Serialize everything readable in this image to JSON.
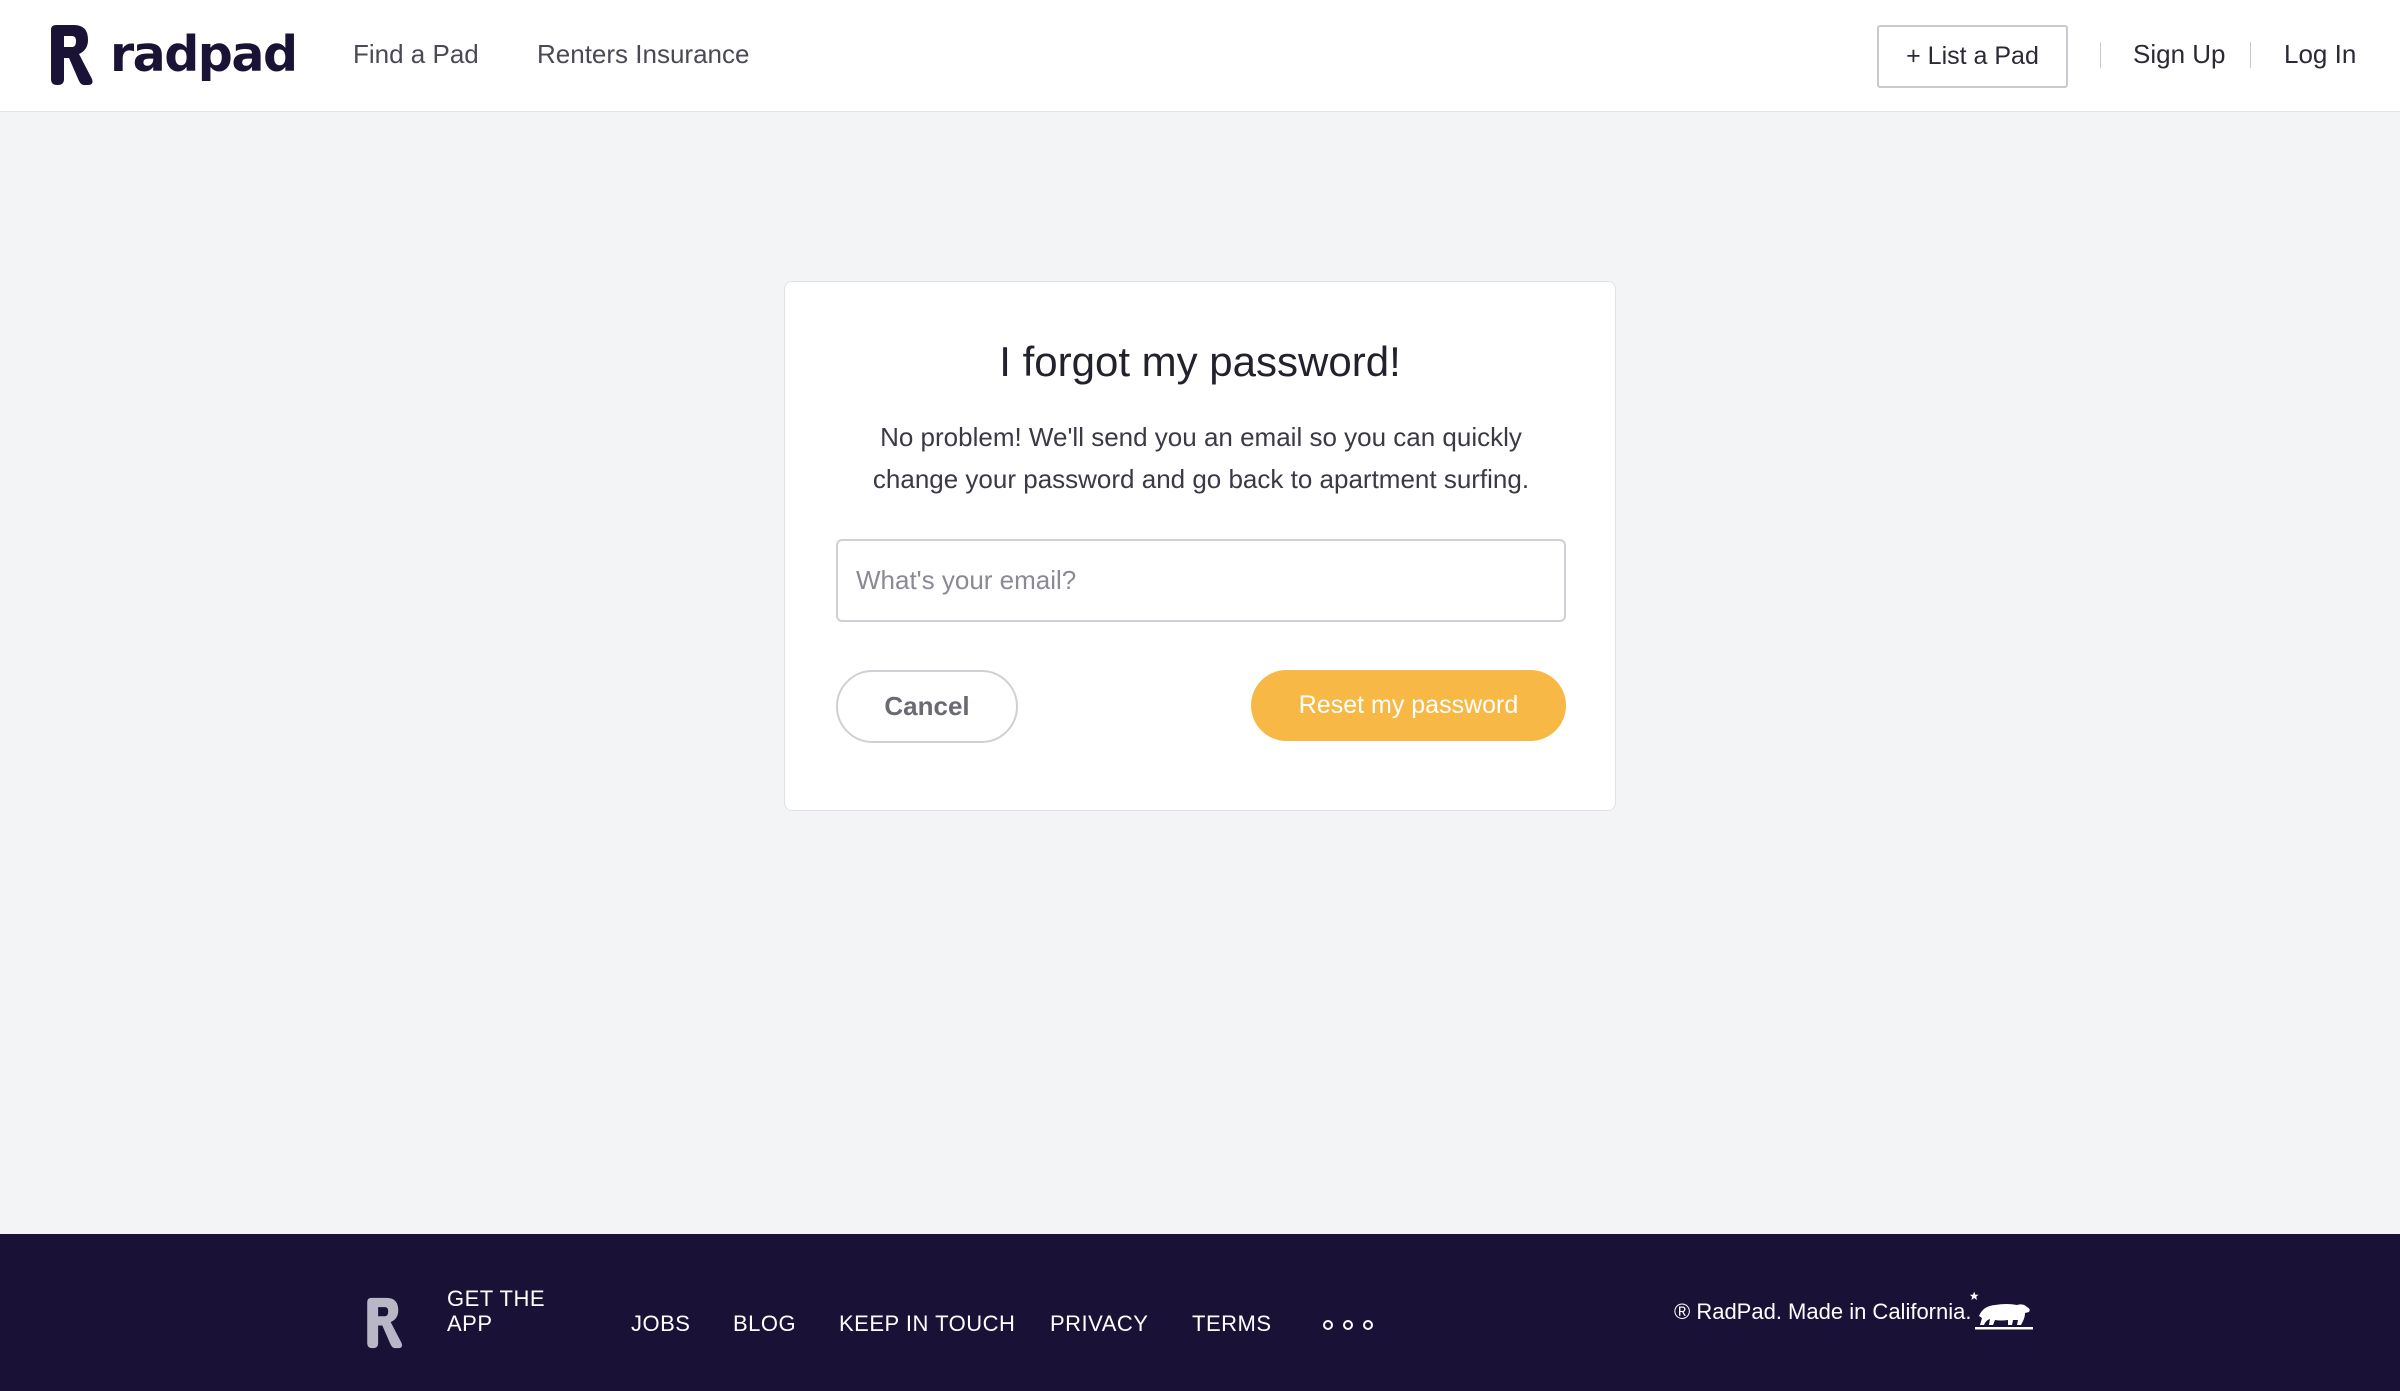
{
  "header": {
    "brand": "radpad",
    "nav": {
      "find_pad": "Find a Pad",
      "renters_insurance": "Renters Insurance"
    },
    "list_pad": "+ List a Pad",
    "sign_up": "Sign Up",
    "log_in": "Log In"
  },
  "form": {
    "title": "I forgot my password!",
    "description": "No problem! We'll send you an email so you can quickly change your password and go back to apartment surfing.",
    "email_placeholder": "What's your email?",
    "email_value": "",
    "cancel": "Cancel",
    "reset": "Reset my password"
  },
  "footer": {
    "get_app_line1": "GET THE",
    "get_app_line2": "APP",
    "links": {
      "jobs": "JOBS",
      "blog": "BLOG",
      "keep_in_touch": "KEEP IN TOUCH",
      "privacy": "PRIVACY",
      "terms": "TERMS"
    },
    "copyright": "® RadPad. Made in California."
  },
  "colors": {
    "brand_navy": "#1b1336",
    "footer_bg": "#1a1236",
    "accent_yellow": "#f7b846",
    "page_bg": "#f3f4f6"
  },
  "icons": [
    "radpad-logo-icon",
    "footer-radpad-icon",
    "more-dots-icon",
    "california-bear-icon"
  ]
}
